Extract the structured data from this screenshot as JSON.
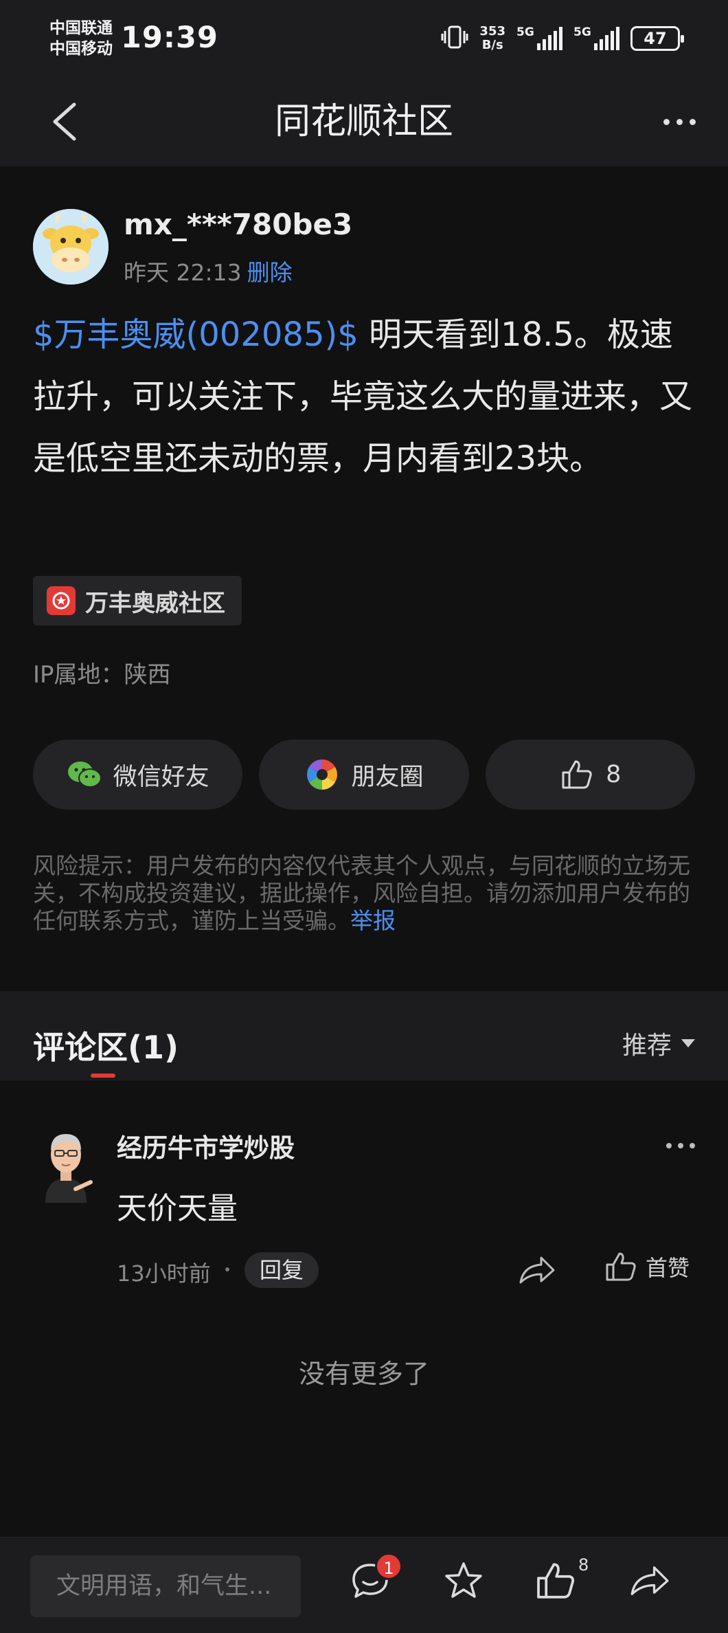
{
  "status_bar": {
    "carrier_1": "中国联通",
    "carrier_2": "中国移动",
    "time": "19:39",
    "net_speed_value": "353",
    "net_speed_unit": "B/s",
    "signal_1_label": "5G",
    "signal_2_label": "5G",
    "battery": "47"
  },
  "nav": {
    "title": "同花顺社区"
  },
  "post": {
    "username": "mx_***780be3",
    "time": "昨天 22:13",
    "delete_label": "删除",
    "stock_link": "$万丰奥威(002085)$",
    "body": " 明天看到18.5。极速拉升，可以关注下，毕竟这么大的量进来，又是低空里还未动的票，月内看到23块。",
    "community_tag": "万丰奥威社区",
    "ip_location": "IP属地：陕西",
    "share_wechat": "微信好友",
    "share_moments": "朋友圈",
    "like_count": "8",
    "risk_notice": "风险提示：用户发布的内容仅代表其个人观点，与同花顺的立场无关，不构成投资建议，据此操作，风险自担。请勿添加用户发布的任何联系方式，谨防上当受骗。",
    "report_label": "举报"
  },
  "comments_section": {
    "title": "评论区(1)",
    "sort_label": "推荐",
    "comments": [
      {
        "author": "经历牛市学炒股",
        "text": "天价天量",
        "time": "13小时前",
        "reply_label": "回复",
        "like_label": "首赞"
      }
    ],
    "no_more": "没有更多了"
  },
  "bottom_bar": {
    "input_placeholder": "文明用语，和气生...",
    "comment_badge": "1",
    "like_count": "8"
  },
  "colors": {
    "accent_blue": "#4c8ff0",
    "brand_red": "#e33a36",
    "background": "#111112",
    "panel": "#1c1c1e"
  }
}
